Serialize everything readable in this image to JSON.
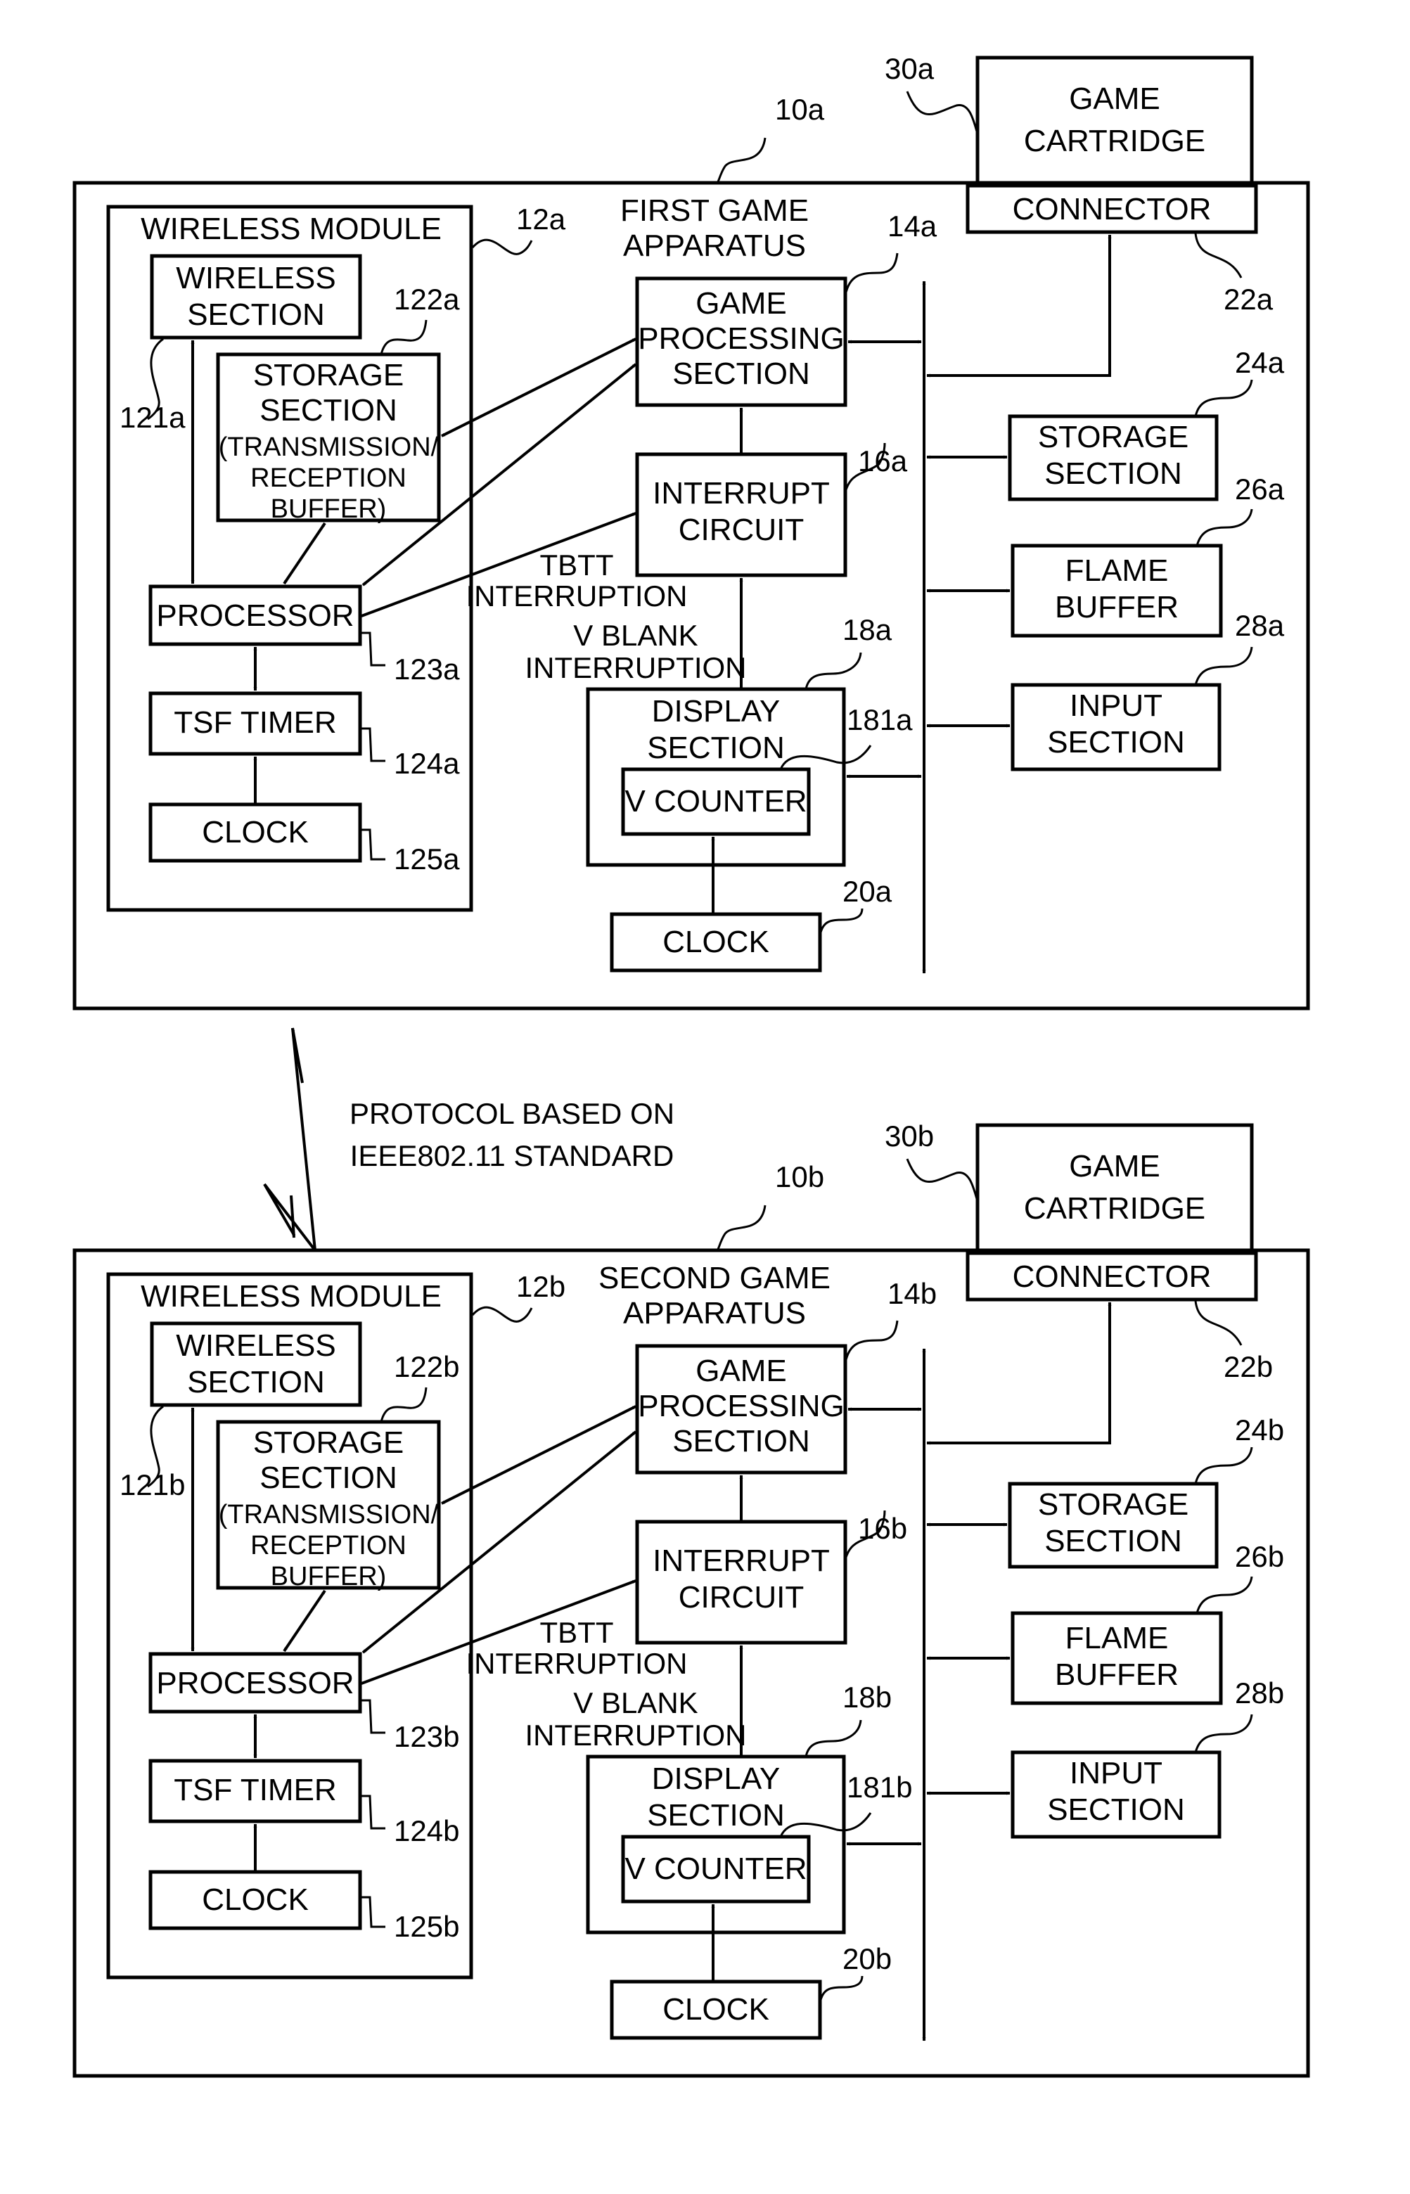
{
  "protocol": {
    "line1": "PROTOCOL BASED ON",
    "line2": "IEEE802.11 STANDARD"
  },
  "apparatuses": [
    {
      "title": [
        "FIRST GAME",
        "APPARATUS"
      ],
      "ref": "10a",
      "wireless_module": {
        "title": "WIRELESS MODULE",
        "ref": "12a"
      },
      "wireless_section": {
        "lines": [
          "WIRELESS",
          "SECTION"
        ],
        "ref": "121a"
      },
      "module_storage": {
        "lines": [
          "STORAGE",
          "SECTION",
          "(TRANSMISSION/",
          "RECEPTION",
          "BUFFER)"
        ],
        "ref": "122a"
      },
      "processor": {
        "label": "PROCESSOR",
        "ref": "123a"
      },
      "tsf_timer": {
        "label": "TSF TIMER",
        "ref": "124a"
      },
      "module_clock": {
        "label": "CLOCK",
        "ref": "125a"
      },
      "game_processing": {
        "lines": [
          "GAME",
          "PROCESSING",
          "SECTION"
        ],
        "ref": "14a"
      },
      "interrupt_circuit": {
        "lines": [
          "INTERRUPT",
          "CIRCUIT"
        ],
        "ref": "16a"
      },
      "tbtt_label": [
        "TBTT",
        "INTERRUPTION"
      ],
      "vblank_label": [
        "V BLANK",
        "INTERRUPTION"
      ],
      "display_section": {
        "lines": [
          "DISPLAY",
          "SECTION"
        ],
        "ref": "18a"
      },
      "v_counter": {
        "label": "V COUNTER",
        "ref": "181a"
      },
      "clock": {
        "label": "CLOCK",
        "ref": "20a"
      },
      "connector": {
        "label": "CONNECTOR",
        "ref": "22a"
      },
      "storage": {
        "lines": [
          "STORAGE",
          "SECTION"
        ],
        "ref": "24a"
      },
      "flame_buffer": {
        "lines": [
          "FLAME",
          "BUFFER"
        ],
        "ref": "26a"
      },
      "input_section": {
        "lines": [
          "INPUT",
          "SECTION"
        ],
        "ref": "28a"
      },
      "cartridge": {
        "lines": [
          "GAME",
          "CARTRIDGE"
        ],
        "ref": "30a"
      }
    },
    {
      "title": [
        "SECOND GAME",
        "APPARATUS"
      ],
      "ref": "10b",
      "wireless_module": {
        "title": "WIRELESS MODULE",
        "ref": "12b"
      },
      "wireless_section": {
        "lines": [
          "WIRELESS",
          "SECTION"
        ],
        "ref": "121b"
      },
      "module_storage": {
        "lines": [
          "STORAGE",
          "SECTION",
          "(TRANSMISSION/",
          "RECEPTION",
          "BUFFER)"
        ],
        "ref": "122b"
      },
      "processor": {
        "label": "PROCESSOR",
        "ref": "123b"
      },
      "tsf_timer": {
        "label": "TSF TIMER",
        "ref": "124b"
      },
      "module_clock": {
        "label": "CLOCK",
        "ref": "125b"
      },
      "game_processing": {
        "lines": [
          "GAME",
          "PROCESSING",
          "SECTION"
        ],
        "ref": "14b"
      },
      "interrupt_circuit": {
        "lines": [
          "INTERRUPT",
          "CIRCUIT"
        ],
        "ref": "16b"
      },
      "tbtt_label": [
        "TBTT",
        "INTERRUPTION"
      ],
      "vblank_label": [
        "V BLANK",
        "INTERRUPTION"
      ],
      "display_section": {
        "lines": [
          "DISPLAY",
          "SECTION"
        ],
        "ref": "18b"
      },
      "v_counter": {
        "label": "V COUNTER",
        "ref": "181b"
      },
      "clock": {
        "label": "CLOCK",
        "ref": "20b"
      },
      "connector": {
        "label": "CONNECTOR",
        "ref": "22b"
      },
      "storage": {
        "lines": [
          "STORAGE",
          "SECTION"
        ],
        "ref": "24b"
      },
      "flame_buffer": {
        "lines": [
          "FLAME",
          "BUFFER"
        ],
        "ref": "26b"
      },
      "input_section": {
        "lines": [
          "INPUT",
          "SECTION"
        ],
        "ref": "28b"
      },
      "cartridge": {
        "lines": [
          "GAME",
          "CARTRIDGE"
        ],
        "ref": "30b"
      }
    }
  ]
}
